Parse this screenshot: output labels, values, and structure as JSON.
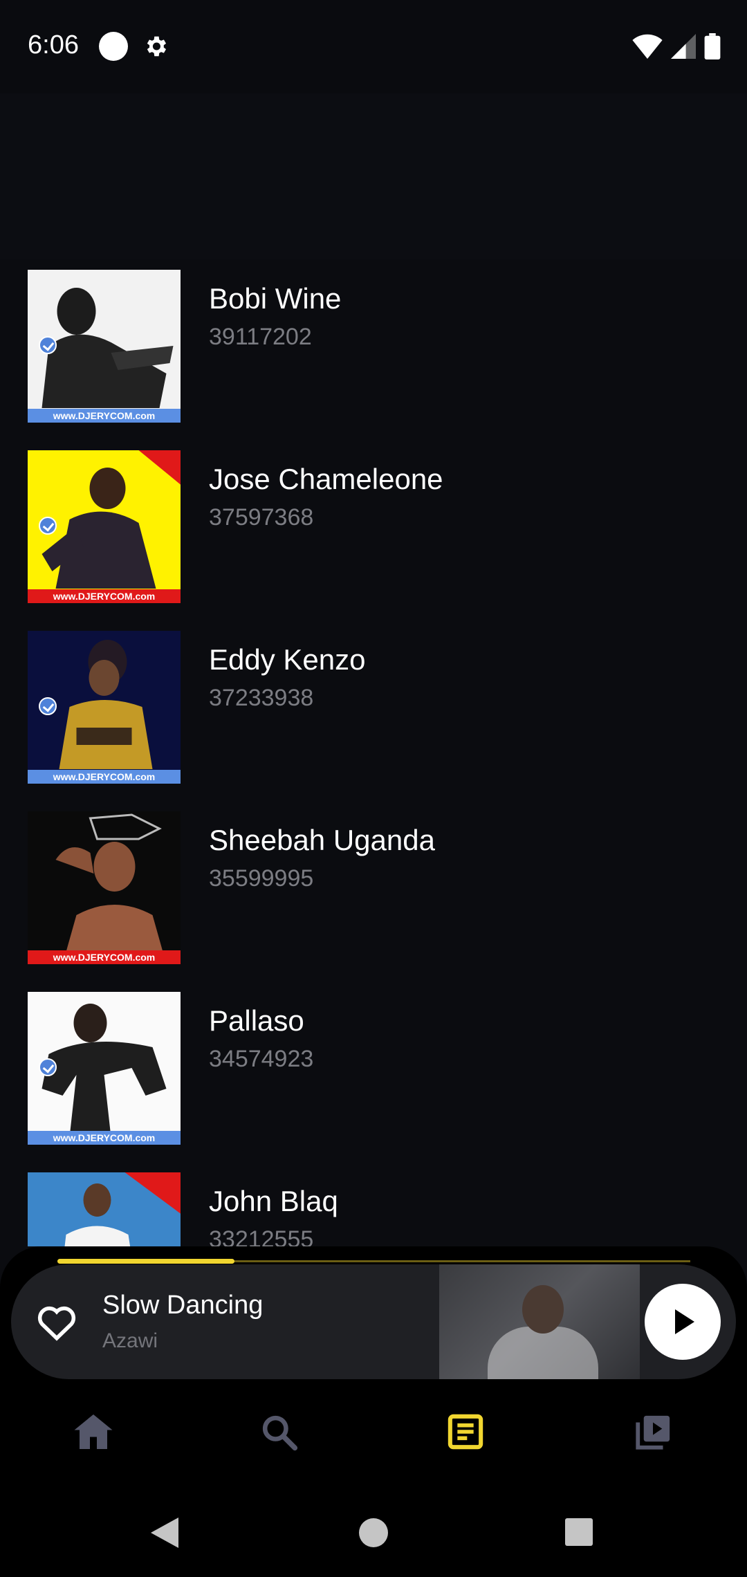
{
  "status_bar": {
    "time": "6:06"
  },
  "artists": [
    {
      "name": "Bobi Wine",
      "count": "39117202",
      "banner": "www.DJERYCOM.com",
      "banner_color": "#5b8fe3",
      "bg": "#f2f2f2",
      "verified": true
    },
    {
      "name": "Jose Chameleone",
      "count": "37597368",
      "banner": "www.DJERYCOM.com",
      "banner_color": "#e01919",
      "bg": "#fff200",
      "verified": true
    },
    {
      "name": "Eddy Kenzo",
      "count": "37233938",
      "banner": "www.DJERYCOM.com",
      "banner_color": "#5b8fe3",
      "bg": "#0a0f3d",
      "verified": true
    },
    {
      "name": "Sheebah Uganda",
      "count": "35599995",
      "banner": "www.DJERYCOM.com",
      "banner_color": "#e01919",
      "bg": "#0a0a0a",
      "verified": false
    },
    {
      "name": "Pallaso",
      "count": "34574923",
      "banner": "www.DJERYCOM.com",
      "banner_color": "#5b8fe3",
      "bg": "#fafafa",
      "verified": true
    },
    {
      "name": "John Blaq",
      "count": "33212555",
      "banner": "",
      "banner_color": "#e01919",
      "bg": "#3c86c9",
      "verified": false
    }
  ],
  "player": {
    "title": "Slow Dancing",
    "artist": "Azawi",
    "progress_fraction": 0.28
  },
  "nav": {
    "items": [
      "home-icon",
      "search-icon",
      "library-icon",
      "videos-icon"
    ],
    "active_index": 2,
    "active_color": "#f1d630",
    "inactive_color": "#55576a"
  },
  "colors": {
    "background": "#0b0c10",
    "accent": "#f1d630",
    "subtext": "#7c7d83"
  }
}
